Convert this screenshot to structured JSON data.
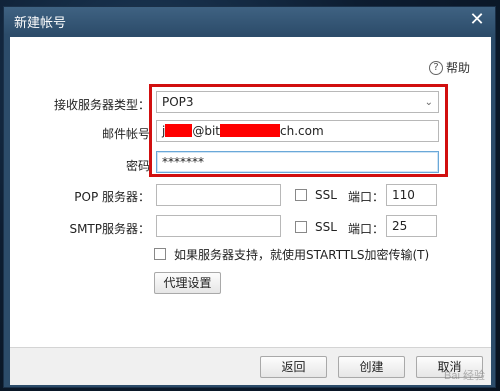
{
  "dialog": {
    "title": "新建帐号",
    "close_symbol": "✕"
  },
  "help": {
    "label": "帮助",
    "icon_text": "?"
  },
  "form": {
    "server_type": {
      "label": "接收服务器类型：",
      "value": "POP3"
    },
    "email": {
      "label": "邮件帐号",
      "value_prefix": "j",
      "value_mid": "@bit",
      "value_suffix": "ch.com"
    },
    "password": {
      "label": "密码",
      "value": "*******"
    },
    "pop": {
      "label": "POP 服务器：",
      "value": "",
      "ssl_label": "SSL",
      "port_label": "端口：",
      "port_value": "110"
    },
    "smtp": {
      "label": "SMTP服务器：",
      "value": "",
      "ssl_label": "SSL",
      "port_label": "端口：",
      "port_value": "25"
    },
    "starttls_label": "如果服务器支持，就使用STARTTLS加密传输(T)",
    "proxy_button": "代理设置"
  },
  "footer": {
    "back_button": "返回",
    "create_button": "创建",
    "cancel_button": "取消"
  },
  "annotation": {
    "highlight_color": "#d10f0f",
    "redaction_color": "#ff0000"
  },
  "watermark": "Bai 经验"
}
